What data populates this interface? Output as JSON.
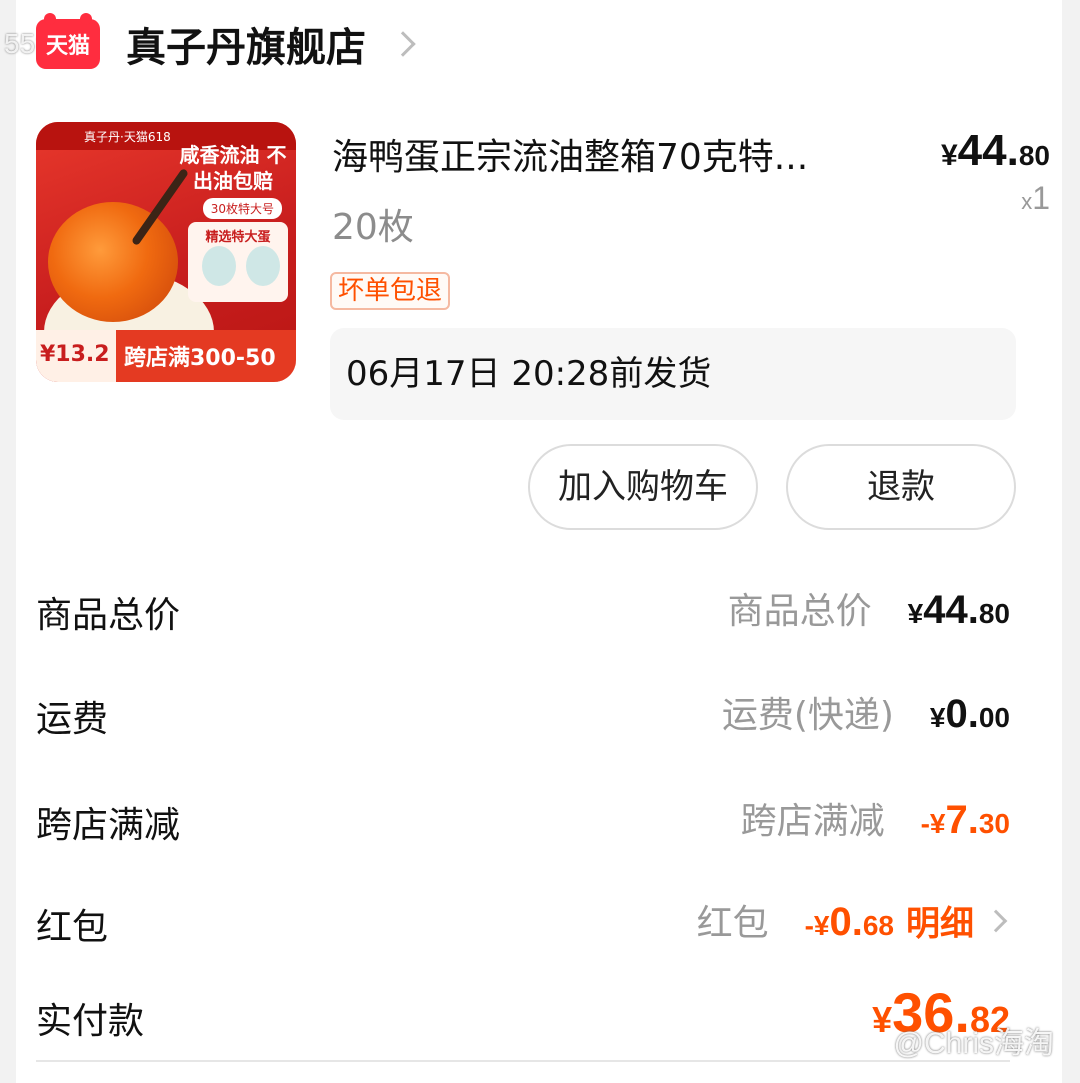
{
  "watermark_left": "55海淘",
  "watermark_right": "@Chris海淘",
  "shop": {
    "logo_text": "天猫",
    "name": "真子丹旗舰店"
  },
  "product": {
    "image": {
      "top_text": "真子丹·天猫618",
      "promo_lines": "咸香流油 不出油包赔",
      "size_tag": "30枚特大号",
      "feature": "精选特大蛋",
      "bottom_price": "¥13.2",
      "bottom_banner": "跨店满300-50"
    },
    "title": "海鸭蛋正宗流油整箱70克特...",
    "spec": "20枚",
    "price": {
      "currency": "¥",
      "integer": "44.",
      "decimal": "80"
    },
    "quantity": {
      "x": "x",
      "count": "1"
    },
    "guarantee_tag": "坏单包退",
    "ship_notice": "06月17日 20:28前发货"
  },
  "actions": {
    "add_to_cart": "加入购物车",
    "refund": "退款"
  },
  "summary": [
    {
      "label": "商品总价",
      "sub": "商品总价",
      "sign": "",
      "currency": "¥",
      "integer": "44.",
      "decimal": "80"
    },
    {
      "label": "运费",
      "sub": "运费(快递)",
      "sign": "",
      "currency": "¥",
      "integer": "0.",
      "decimal": "00"
    },
    {
      "label": "跨店满减",
      "sub": "跨店满减",
      "sign": "-",
      "currency": "¥",
      "integer": "7.",
      "decimal": "30"
    },
    {
      "label": "红包",
      "sub": "红包",
      "sign": "-",
      "currency": "¥",
      "integer": "0.",
      "decimal": "68",
      "link": "明细"
    }
  ],
  "total": {
    "label": "实付款",
    "currency": "¥",
    "integer": "36.",
    "decimal": "82"
  },
  "colors": {
    "accent": "#ff5000",
    "tmall_red": "#ff2d3f",
    "muted": "#999999"
  }
}
